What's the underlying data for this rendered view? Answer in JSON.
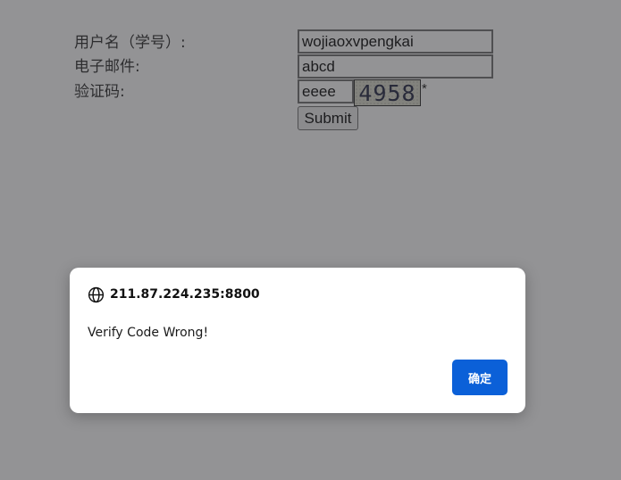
{
  "form": {
    "username_label": "用户名（学号）:",
    "username_value": "wojiaoxvpengkai",
    "email_label": "电子邮件:",
    "email_value": "abcd",
    "captcha_label": "验证码:",
    "captcha_value": "eeee",
    "captcha_image_text": "4958",
    "required_mark": "*",
    "submit_label": "Submit"
  },
  "dialog": {
    "origin": "211.87.224.235:8800",
    "message": "Verify Code Wrong!",
    "ok_label": "确定",
    "icon": "globe-icon",
    "button_color": "#0b60d8"
  }
}
